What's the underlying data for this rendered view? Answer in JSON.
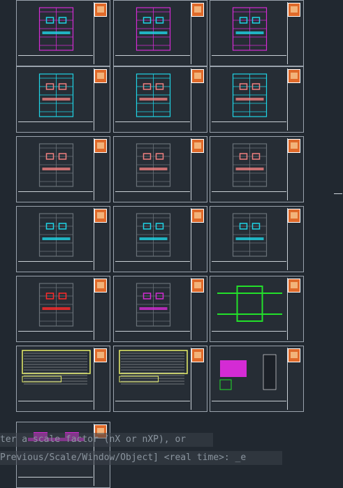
{
  "command": {
    "line1": "ter a scale factor (nX or nXP), or",
    "line2": "Previous/Scale/Window/Object] <real time>: _e"
  },
  "sheet_styles": [
    "magenta-cyan",
    "magenta-cyan",
    "magenta-cyan",
    "cyan-pink",
    "cyan-pink",
    "cyan-pink",
    "gray-pink",
    "gray-pink",
    "gray-pink",
    "gray-cyan",
    "gray-cyan",
    "gray-cyan",
    "gray-red",
    "gray-magenta",
    "green",
    "table",
    "table",
    "legend",
    "magenta-section"
  ],
  "colors": {
    "background": "#212830",
    "magenta": "#d42bd4",
    "cyan": "#1fd4e6",
    "pink": "#f08080",
    "green": "#23e02a",
    "yellow": "#e8f06a",
    "gray": "#6a7178"
  }
}
